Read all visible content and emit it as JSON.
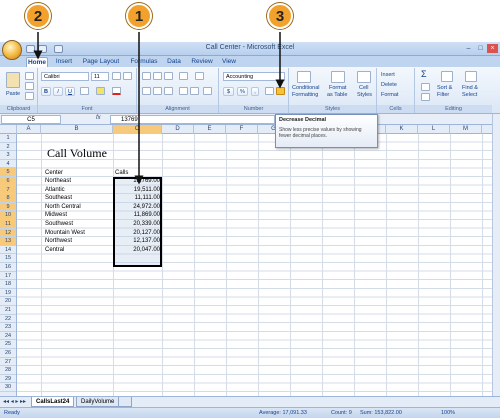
{
  "window": {
    "title": "Call Center - Microsoft Excel"
  },
  "callouts": [
    "2",
    "1",
    "3"
  ],
  "tabs": [
    "Home",
    "Insert",
    "Page Layout",
    "Formulas",
    "Data",
    "Review",
    "View"
  ],
  "ribbon": {
    "clipboard": {
      "paste": "Paste",
      "label": "Clipboard"
    },
    "font": {
      "name": "Calibri",
      "size": "11",
      "label": "Font"
    },
    "alignment": {
      "label": "Alignment"
    },
    "number": {
      "format": "Accounting",
      "currency": "$",
      "percent": "%",
      "comma": ",",
      "label": "Number"
    },
    "styles": {
      "cond": "Conditional",
      "cond2": "Formatting",
      "format_table": "Format",
      "format_table2": "as Table",
      "cell_styles": "Cell",
      "cell_styles2": "Styles",
      "label": "Styles"
    },
    "cells": {
      "insert": "Insert",
      "delete": "Delete",
      "format": "Format",
      "label": "Cells"
    },
    "editing": {
      "sum": "Σ",
      "sort": "Sort &",
      "sort2": "Filter",
      "find": "Find &",
      "find2": "Select",
      "label": "Editing"
    }
  },
  "tooltip": {
    "title": "Decrease Decimal",
    "body": "Show less precise values by showing fewer decimal places."
  },
  "formula": {
    "namebox": "C5",
    "fx": "fx",
    "value": "13769"
  },
  "columns": [
    "A",
    "B",
    "C",
    "D",
    "E",
    "F",
    "G",
    "H",
    "I",
    "J",
    "K",
    "L",
    "M"
  ],
  "rows": [
    "1",
    "2",
    "3",
    "4",
    "5",
    "6",
    "7",
    "8",
    "9",
    "10",
    "11",
    "12",
    "13",
    "14",
    "15",
    "16",
    "17",
    "18",
    "19",
    "20",
    "21",
    "22",
    "23",
    "24",
    "25",
    "26",
    "27",
    "28",
    "29",
    "30"
  ],
  "sheet": {
    "title": "Call Volume",
    "header_center": "Center",
    "header_calls": "Calls",
    "data": [
      {
        "center": "Northeast",
        "calls": "13,769.00"
      },
      {
        "center": "Atlantic",
        "calls": "19,511.00"
      },
      {
        "center": "Southeast",
        "calls": "11,111.00"
      },
      {
        "center": "North Central",
        "calls": "24,972.00"
      },
      {
        "center": "Midwest",
        "calls": "11,869.00"
      },
      {
        "center": "Southwest",
        "calls": "20,339.00"
      },
      {
        "center": "Mountain West",
        "calls": "20,127.00"
      },
      {
        "center": "Northwest",
        "calls": "12,137.00"
      },
      {
        "center": "Central",
        "calls": "20,047.00"
      }
    ]
  },
  "sheet_tabs": [
    "CallsLast24",
    "DailyVolume"
  ],
  "status": {
    "ready": "Ready",
    "average": "Average: 17,091.33",
    "count": "Count: 9",
    "sum": "Sum: 153,822.00",
    "zoom": "100%"
  }
}
